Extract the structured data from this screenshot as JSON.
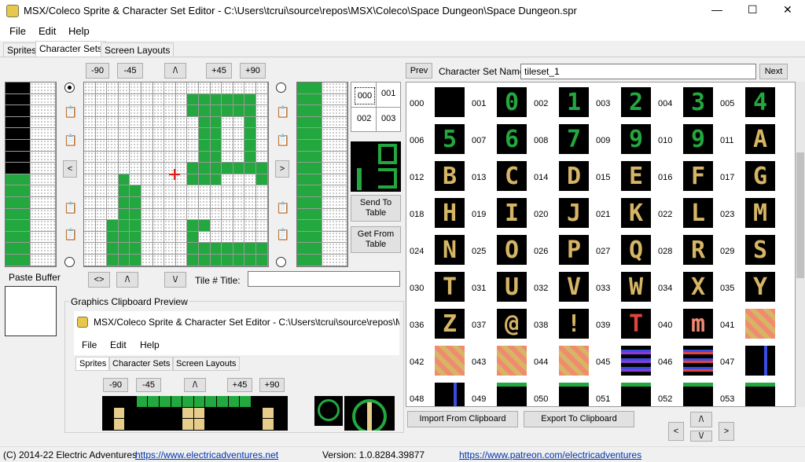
{
  "window": {
    "title": "MSX/Coleco Sprite & Character Set Editor - C:\\Users\\tcrui\\source\\repos\\MSX\\Coleco\\Space Dungeon\\Space Dungeon.spr",
    "min": "—",
    "max": "☐",
    "close": "✕"
  },
  "menu": [
    "File",
    "Edit",
    "Help"
  ],
  "tabs": [
    "Sprites",
    "Character Sets",
    "Screen Layouts"
  ],
  "rotate": {
    "m90": "-90",
    "m45": "-45",
    "up": "/\\",
    "p45": "+45",
    "p90": "+90"
  },
  "nav": {
    "left": "<",
    "right": ">",
    "flip_h": "<>",
    "flip_v": "/\\",
    "down": "\\/"
  },
  "tilegrid": [
    "000",
    "001",
    "002",
    "003"
  ],
  "send_to_table": "Send To Table",
  "get_from_table": "Get From Table",
  "paste_buffer": "Paste Buffer",
  "tile_title_label": "Tile # Title:",
  "tile_title_value": "",
  "clipboard_preview": {
    "label": "Graphics Clipboard Preview",
    "title": "MSX/Coleco Sprite & Character Set Editor - C:\\Users\\tcrui\\source\\repos\\M",
    "menu": [
      "File",
      "Edit",
      "Help"
    ],
    "tabs": [
      "Sprites",
      "Character Sets",
      "Screen Layouts"
    ],
    "rot": [
      "-90",
      "-45",
      "/\\",
      "+45",
      "+90"
    ]
  },
  "charset": {
    "prev": "Prev",
    "next": "Next",
    "name_label": "Character Set Name",
    "name_value": "tileset_1",
    "tiles": [
      "000",
      "001",
      "002",
      "003",
      "004",
      "005",
      "006",
      "007",
      "008",
      "009",
      "010",
      "011",
      "012",
      "013",
      "014",
      "015",
      "016",
      "017",
      "018",
      "019",
      "020",
      "021",
      "022",
      "023",
      "024",
      "025",
      "026",
      "027",
      "028",
      "029",
      "030",
      "031",
      "032",
      "033",
      "034",
      "035",
      "036",
      "037",
      "038",
      "039",
      "040",
      "041",
      "042",
      "043",
      "044",
      "045",
      "046",
      "047",
      "048",
      "049",
      "050",
      "051",
      "052",
      "053"
    ],
    "glyphs": [
      "",
      "0",
      "1",
      "2",
      "3",
      "4",
      "5",
      "6",
      "7",
      "9",
      "9",
      "A",
      "B",
      "C",
      "D",
      "E",
      "F",
      "G",
      "H",
      "I",
      "J",
      "K",
      "L",
      "M",
      "N",
      "O",
      "P",
      "Q",
      "R",
      "S",
      "T",
      "U",
      "V",
      "W",
      "X",
      "Y",
      "Z",
      "@",
      "!",
      "T",
      "m",
      "",
      "",
      "",
      "",
      "",
      "",
      "",
      "",
      "",
      "",
      "",
      "",
      ""
    ]
  },
  "import_clipboard": "Import From Clipboard",
  "export_clipboard": "Export To Clipboard",
  "status": {
    "copyright": "(C) 2014-22 Electric Adventures",
    "link1": "https://www.electricadventures.net",
    "version": "Version: 1.0.8284.39877",
    "link2": "https://www.patreon.com/electricadventures"
  }
}
